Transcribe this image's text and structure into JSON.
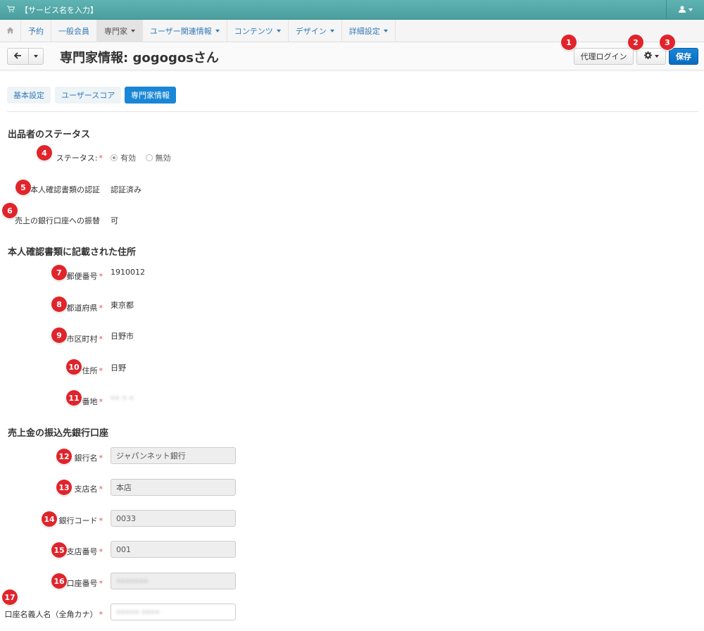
{
  "topbar": {
    "cart_icon": "cart-icon",
    "service_name": "【サービス名を入力】",
    "user_icon": "user-icon"
  },
  "nav": {
    "home_icon": "home-icon",
    "items": [
      {
        "label": "予約"
      },
      {
        "label": "一般会員"
      },
      {
        "label": "専門家"
      },
      {
        "label": "ユーザー関連情報"
      },
      {
        "label": "コンテンツ"
      },
      {
        "label": "デザイン"
      },
      {
        "label": "詳細設定"
      }
    ]
  },
  "header": {
    "title": "専門家情報: gogogosさん",
    "proxy_login": "代理ログイン",
    "save": "保存",
    "gear_icon": "gear-icon",
    "back_icon": "arrow-left-icon"
  },
  "tabs": [
    {
      "label": "基本設定"
    },
    {
      "label": "ユーザースコア"
    },
    {
      "label": "専門家情報"
    }
  ],
  "sections": {
    "status": "出品者のステータス",
    "address": "本人確認書類に記載された住所",
    "bank": "売上金の振込先銀行口座"
  },
  "status": {
    "status_label": "ステータス:",
    "opt_enabled": "有効",
    "opt_disabled": "無効",
    "identity_label": "本人確認書類の認証",
    "identity_value": "認証済み",
    "transfer_label": "売上の銀行口座への振替",
    "transfer_value": "可"
  },
  "address": {
    "postal_label": "郵便番号",
    "postal_value": "1910012",
    "pref_label": "都道府県",
    "pref_value": "東京都",
    "city_label": "市区町村",
    "city_value": "日野市",
    "addr_label": "住所",
    "addr_value": "日野",
    "block_label": "番地",
    "block_value": "•• • •"
  },
  "bank": {
    "bank_name_label": "銀行名",
    "bank_name_value": "ジャパンネット銀行",
    "branch_name_label": "支店名",
    "branch_name_value": "本店",
    "bank_code_label": "銀行コード",
    "bank_code_value": "0033",
    "branch_no_label": "支店番号",
    "branch_no_value": "001",
    "account_no_label": "口座番号",
    "account_no_value": "•••••••",
    "holder_label": "口座名義人名（全角カナ）",
    "holder_value": "••••• ••••"
  },
  "required_mark": "*",
  "badges": [
    "1",
    "2",
    "3",
    "4",
    "5",
    "6",
    "7",
    "8",
    "9",
    "10",
    "11",
    "12",
    "13",
    "14",
    "15",
    "16",
    "17"
  ],
  "colors": {
    "topbar": "#4a9e9e",
    "primary": "#1a86d6",
    "badge": "#e0242b",
    "required": "#d9534f"
  }
}
